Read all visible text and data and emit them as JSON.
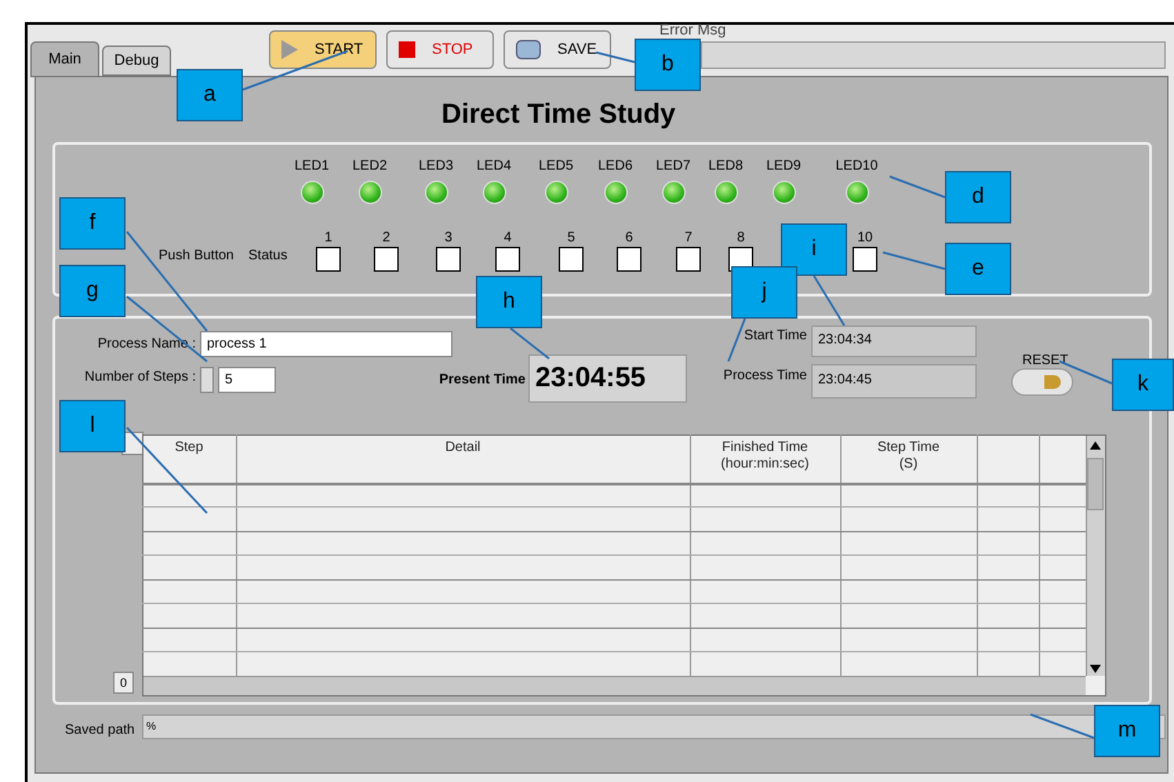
{
  "tabs": [
    {
      "label": "Main",
      "selected": true
    },
    {
      "label": "Debug",
      "selected": false
    }
  ],
  "buttons": [
    {
      "kind": "start",
      "label": "START"
    },
    {
      "kind": "stop",
      "label": "STOP"
    },
    {
      "kind": "save",
      "label": "SAVE"
    }
  ],
  "error_msg": {
    "label": "Error Msg"
  },
  "title": "Direct Time Study",
  "leds": [
    {
      "label": "LED1",
      "on": true
    },
    {
      "label": "LED2",
      "on": true
    },
    {
      "label": "LED3",
      "on": true
    },
    {
      "label": "LED4",
      "on": true
    },
    {
      "label": "LED5",
      "on": true
    },
    {
      "label": "LED6",
      "on": true
    },
    {
      "label": "LED7",
      "on": true
    },
    {
      "label": "LED8",
      "on": true
    },
    {
      "label": "LED9",
      "on": true
    },
    {
      "label": "LED10",
      "on": true
    }
  ],
  "push_button_status": {
    "label_1": "Push Button",
    "label_2": "Status",
    "buttons": [
      {
        "label": "1",
        "checked": false
      },
      {
        "label": "2",
        "checked": false
      },
      {
        "label": "3",
        "checked": false
      },
      {
        "label": "4",
        "checked": false
      },
      {
        "label": "5",
        "checked": false
      },
      {
        "label": "6",
        "checked": false
      },
      {
        "label": "7",
        "checked": false
      },
      {
        "label": "8",
        "checked": false
      },
      {
        "label": "10",
        "checked": false
      }
    ]
  },
  "process_name": {
    "label": "Process Name :",
    "value": "process 1"
  },
  "number_of_steps": {
    "label": "Number of Steps :",
    "value": "5"
  },
  "present_time": {
    "label": "Present Time",
    "value": "23:04:55"
  },
  "start_time": {
    "label": "Start Time",
    "value": "23:04:34"
  },
  "process_time": {
    "label": "Process Time",
    "value": "23:04:45"
  },
  "reset": {
    "label": "RESET"
  },
  "table": {
    "columns": [
      {
        "title": "Step"
      },
      {
        "title": "Detail"
      },
      {
        "title": "Finished Time",
        "subtitle": "(hour:min:sec)"
      },
      {
        "title": "Step Time",
        "subtitle": "(S)"
      }
    ],
    "index": "0"
  },
  "saved_path": {
    "label": "Saved path",
    "value": "%"
  },
  "callouts": [
    "a",
    "b",
    "d",
    "e",
    "f",
    "g",
    "h",
    "i",
    "j",
    "k",
    "l",
    "m"
  ]
}
